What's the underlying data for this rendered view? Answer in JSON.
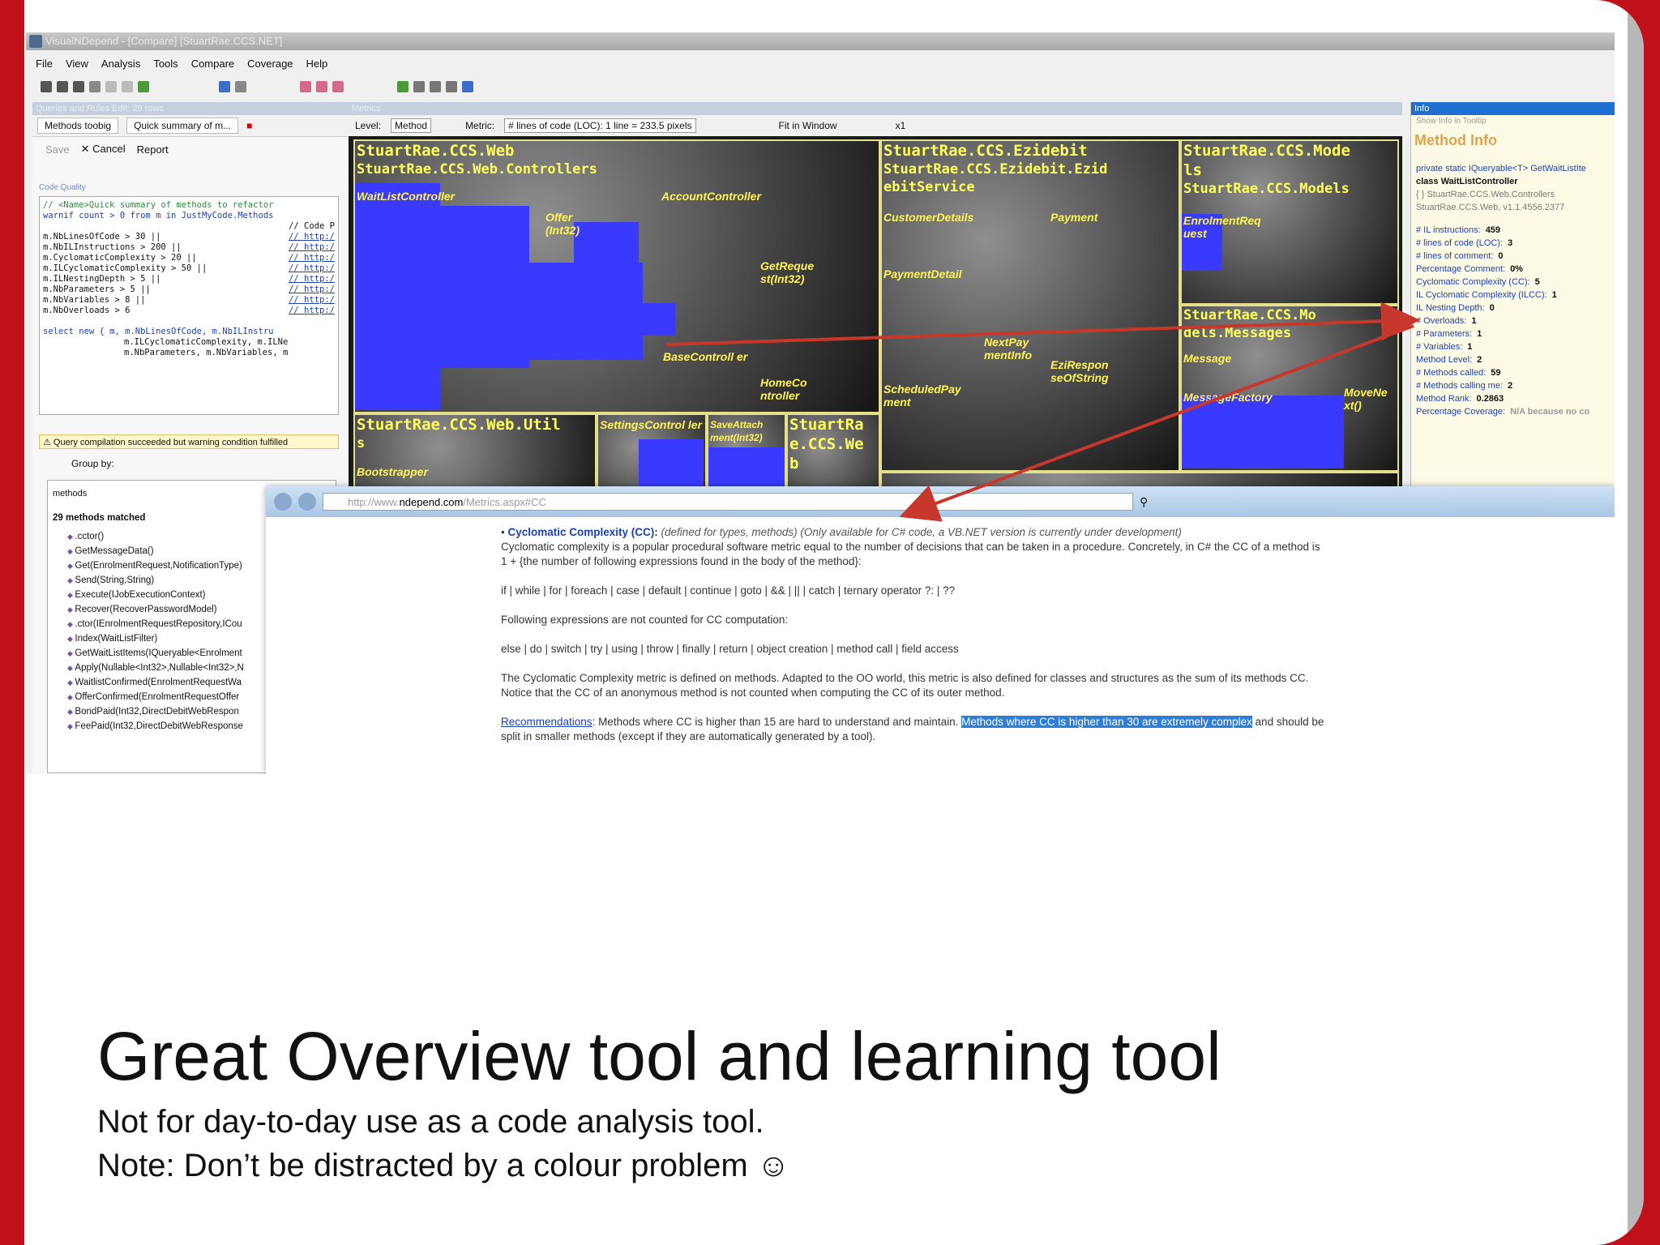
{
  "app": {
    "window_title": "VisualNDepend - [Compare] [StuartRae.CCS.NET]"
  },
  "menu": [
    "File",
    "View",
    "Analysis",
    "Tools",
    "Compare",
    "Coverage",
    "Help"
  ],
  "left": {
    "panel_title": "Queries and Rules Edit: 29 rows",
    "tab1": "Methods toobig",
    "tab2": "Quick summary of m...",
    "save": "Save",
    "cancel": "Cancel",
    "report": "Report",
    "code_quality": "Code Quality",
    "code": [
      "// <Name>Quick summary of methods to refactor",
      "warnif count > 0 from m in JustMyCode.Methods",
      "// Code P",
      "m.NbLinesOfCode > 30 ||",
      "m.NbILInstructions > 200 ||",
      "m.CyclomaticComplexity > 20 ||",
      "m.ILCyclomaticComplexity > 50 ||",
      "m.ILNestingDepth > 5 ||",
      "m.NbParameters > 5 ||",
      "m.NbVariables > 8 ||",
      "m.NbOverloads > 6",
      "select new { m, m.NbLinesOfCode, m.NbILInstru",
      "m.ILCyclomaticComplexity, m.ILNe",
      "m.NbParameters, m.NbVariables, m"
    ],
    "link": "// http:/",
    "status": "Query compilation succeeded but warning condition fulfilled",
    "group_by": "Group by:",
    "results_header": "methods",
    "matched": "29 methods matched",
    "methods": [
      ".cctor()",
      "GetMessageData()",
      "Get(EnrolmentRequest,NotificationType)",
      "Send(String,String)",
      "Execute(IJobExecutionContext)",
      "Recover(RecoverPasswordModel)",
      ".ctor(IEnrolmentRequestRepository,ICou",
      "Index(WaitListFilter)",
      "GetWaitListItems(IQueryable<Enrolment",
      "Apply(Nullable<Int32>,Nullable<Int32>,N",
      "WaitlistConfirmed(EnrolmentRequestWa",
      "OfferConfirmed(EnrolmentRequestOffer",
      "BondPaid(Int32,DirectDebitWebRespon",
      "FeePaid(Int32,DirectDebitWebResponse"
    ]
  },
  "metric": {
    "panel_title": "Metrics",
    "level_label": "Level:",
    "level_value": "Method",
    "metric_label": "Metric:",
    "metric_value": "# lines of code (LOC): 1 line = 233.5 pixels",
    "fit": "Fit in Window",
    "zoom": "x1",
    "cells": {
      "web": "StuartRae.CCS.Web",
      "controllers": "StuartRae.CCS.Web.Controllers",
      "ezidebit": "StuartRae.CCS.Ezidebit",
      "ezidebit_svc1": "StuartRae.CCS.Ezidebit.Ezid",
      "ezidebit_svc2": "ebitService",
      "models1": "StuartRae.CCS.Mode",
      "models2": "ls",
      "models_ns": "StuartRae.CCS.Models",
      "messages1": "StuartRae.CCS.Mo",
      "messages2": "dels.Messages",
      "util": "StuartRae.CCS.Web.Util",
      "util2": "s",
      "web_b1": "StuartRa",
      "web_b2": "e.CCS.We",
      "web_b3": "b"
    },
    "labels": {
      "waitlist": "WaitListController",
      "account": "AccountController",
      "offer": "Offer (Int32)",
      "getreq": "GetReque st(Int32)",
      "basecontroller": "BaseControll er",
      "homecontroller": "HomeCo ntroller",
      "settings": "SettingsControl ler",
      "saveattach": "SaveAttach ment(Int32)",
      "bootstrapper": "Bootstrapper",
      "customer": "CustomerDetails",
      "payment": "Payment",
      "paymentdetail": "PaymentDetail",
      "nextpay": "NextPay mentInfo",
      "ezirespon": "EziRespon seOfString",
      "scheduled": "ScheduledPay ment",
      "enrolment": "EnrolmentReq uest",
      "message": "Message",
      "messagefactory": "MessageFactory",
      "movenext": "MoveNe xt()"
    }
  },
  "info": {
    "panel_title": "Info",
    "show": "Show Info in Tooltip",
    "method_info": "Method Info",
    "signature": "private static IQueryable<T> GetWaitListIte",
    "class": "class WaitListController",
    "ns": "{ } StuartRae.CCS.Web.Controllers",
    "asm": "StuartRae.CCS.Web, v1.1.4556.2377",
    "rows": [
      {
        "k": "# IL instructions:",
        "v": "459"
      },
      {
        "k": "# lines of code (LOC):",
        "v": "3"
      },
      {
        "k": "# lines of comment:",
        "v": "0"
      },
      {
        "k": "Percentage Comment:",
        "v": "0%"
      },
      {
        "k": "Cyclomatic Complexity (CC):",
        "v": "5"
      },
      {
        "k": "IL Cyclomatic Complexity (ILCC):",
        "v": "1"
      },
      {
        "k": "IL Nesting Depth:",
        "v": "0"
      },
      {
        "k": "# Overloads:",
        "v": "1"
      },
      {
        "k": "# Parameters:",
        "v": "1"
      },
      {
        "k": "# Variables:",
        "v": "1"
      },
      {
        "k": "Method Level:",
        "v": "2"
      },
      {
        "k": "# Methods called:",
        "v": "59"
      },
      {
        "k": "# Methods calling me:",
        "v": "2"
      },
      {
        "k": "Method Rank:",
        "v": "0.2863"
      },
      {
        "k": "Percentage Coverage:",
        "v": "N/A because no co"
      }
    ]
  },
  "browser": {
    "url_prefix": "http://www.",
    "url_domain": "ndepend.com",
    "url_suffix": "/Metrics.aspx#CC",
    "cc_title": "Cyclomatic Complexity (CC):",
    "cc_note": "(defined for types, methods) (Only available for C# code, a VB.NET version is currently under development)",
    "p1": "Cyclomatic complexity is a popular procedural software metric equal to the number of decisions that can be taken in a procedure. Concretely, in C# the CC of a method is 1 + {the number of following expressions found in the body of the method}:",
    "p2": "if | while | for | foreach | case | default | continue | goto | && | || | catch | ternary operator ?: | ??",
    "p3": "Following expressions are not counted for CC computation:",
    "p4": "else | do | switch | try | using | throw | finally | return | object creation | method call | field access",
    "p5": "The Cyclomatic Complexity metric is defined on methods. Adapted to the OO world, this metric is also defined for classes and structures as the sum of its methods CC. Notice that the CC of an anonymous method is not counted when computing the CC of its outer method.",
    "rec_link": "Recommendations",
    "rec_text": ": Methods where CC is higher than 15 are hard to understand and maintain.",
    "rec_hl": "Methods where CC is higher than 30 are extremely complex",
    "rec_end": "and should be split in smaller methods (except if they are automatically generated by a tool)."
  },
  "slide": {
    "title": "Great Overview tool and learning tool",
    "line1": "Not for day-to-day use as a code analysis tool.",
    "line2": "Note: Don’t be distracted by a colour problem ☺"
  },
  "colors": {
    "brand_red": "#c0101a",
    "treemap_border": "#e3df8a",
    "treemap_label": "#ffff5a",
    "highlight_blue": "#3a3aff",
    "arrow": "#c8372b"
  }
}
